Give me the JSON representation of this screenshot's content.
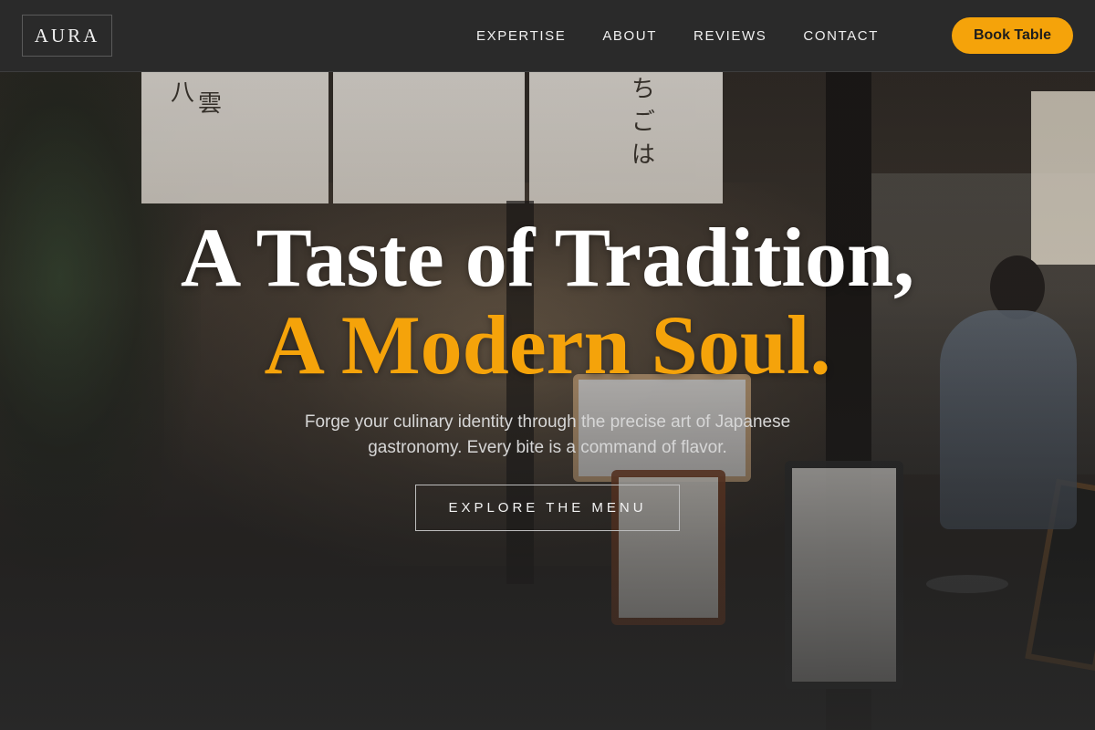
{
  "nav": {
    "logo": "AURA",
    "links": [
      "EXPERTISE",
      "ABOUT",
      "REVIEWS",
      "CONTACT"
    ],
    "book_button": "Book Table"
  },
  "hero": {
    "title_line1": "A Taste of Tradition,",
    "title_line2": "A Modern Soul.",
    "subtitle": "Forge your culinary identity through the precise art of Japanese gastronomy. Every bite is a command of flavor.",
    "cta": "EXPLORE THE MENU",
    "background_image": "restaurant-storefront-photo"
  },
  "colors": {
    "accent": "#f5a30a",
    "nav_background": "#2a2a2a",
    "text_primary": "#ffffff"
  }
}
